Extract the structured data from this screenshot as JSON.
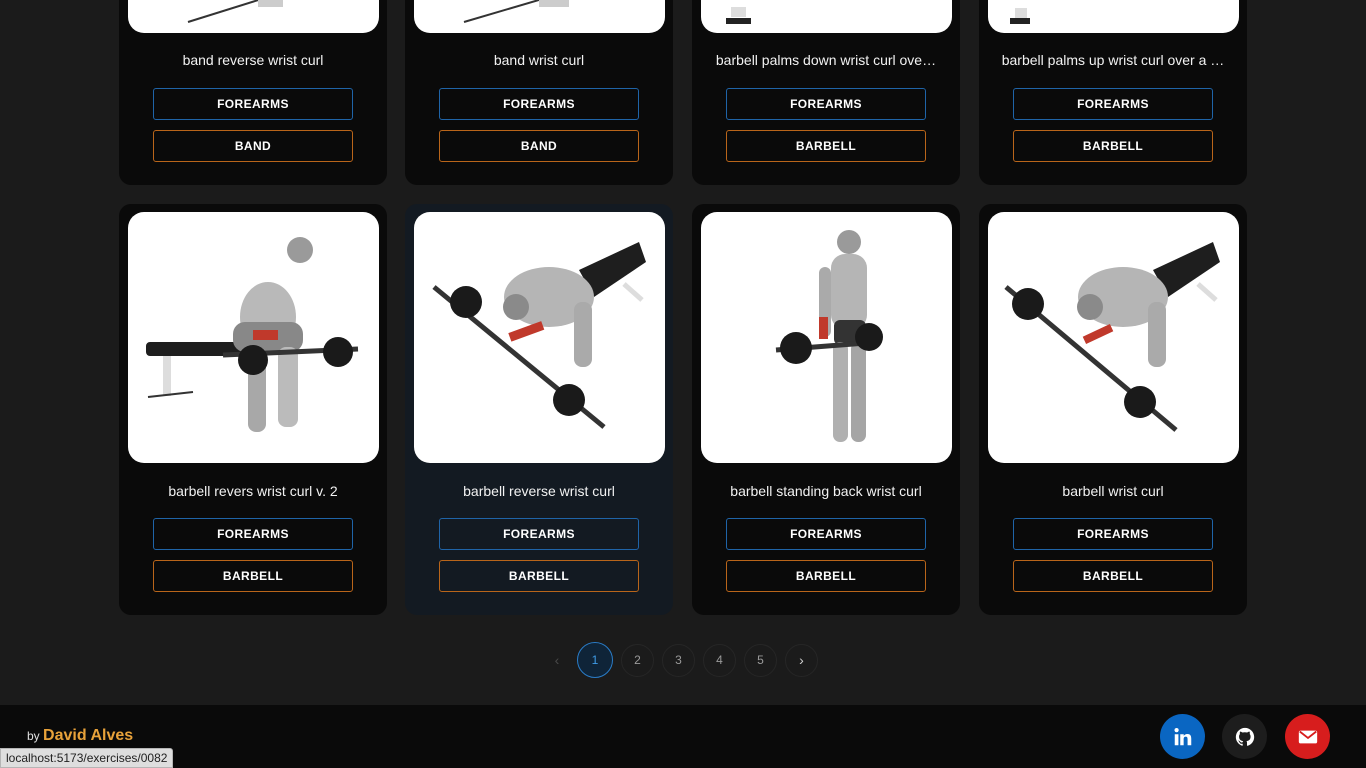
{
  "exercises_row1": [
    {
      "name": "band reverse wrist curl",
      "target": "FOREARMS",
      "equipment": "BAND"
    },
    {
      "name": "band wrist curl",
      "target": "FOREARMS",
      "equipment": "BAND"
    },
    {
      "name": "barbell palms down wrist curl ove…",
      "target": "FOREARMS",
      "equipment": "BARBELL"
    },
    {
      "name": "barbell palms up wrist curl over a …",
      "target": "FOREARMS",
      "equipment": "BARBELL"
    }
  ],
  "exercises_row2": [
    {
      "name": "barbell revers wrist curl v. 2",
      "target": "FOREARMS",
      "equipment": "BARBELL"
    },
    {
      "name": "barbell reverse wrist curl",
      "target": "FOREARMS",
      "equipment": "BARBELL"
    },
    {
      "name": "barbell standing back wrist curl",
      "target": "FOREARMS",
      "equipment": "BARBELL"
    },
    {
      "name": "barbell wrist curl",
      "target": "FOREARMS",
      "equipment": "BARBELL"
    }
  ],
  "pagination": {
    "prev": "‹",
    "pages": [
      "1",
      "2",
      "3",
      "4",
      "5"
    ],
    "active_page": "1",
    "next": "›"
  },
  "footer": {
    "by": "by",
    "author": "David Alves",
    "social": [
      "linkedin-icon",
      "github-icon",
      "mail-icon"
    ]
  },
  "status_url": "localhost:5173/exercises/0082",
  "colors": {
    "muscle_tag_border": "#1f64a8",
    "equipment_tag_border": "#b9651a",
    "author": "#e8a23a",
    "linkedin": "#0a66c2",
    "mail": "#d71d1d"
  }
}
